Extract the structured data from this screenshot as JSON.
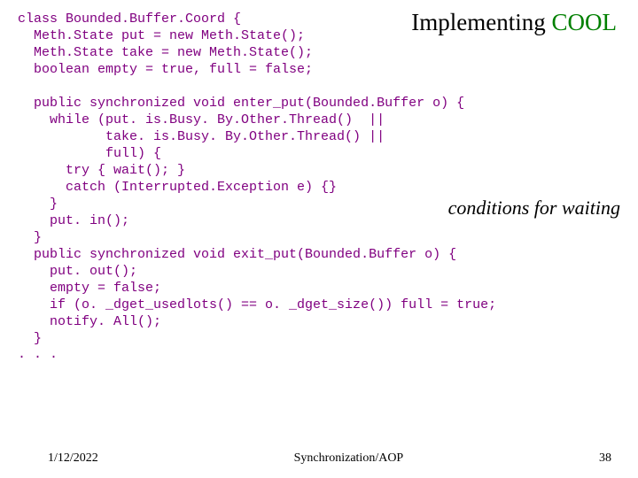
{
  "title": {
    "part1": "Implementing ",
    "part2": "COOL"
  },
  "code": "class Bounded.Buffer.Coord {\n  Meth.State put = new Meth.State();\n  Meth.State take = new Meth.State();\n  boolean empty = true, full = false;\n\n  public synchronized void enter_put(Bounded.Buffer o) {\n    while (put. is.Busy. By.Other.Thread()  ||\n           take. is.Busy. By.Other.Thread() ||\n           full) {\n      try { wait(); }\n      catch (Interrupted.Exception e) {}\n    }\n    put. in();\n  }\n  public synchronized void exit_put(Bounded.Buffer o) {\n    put. out();\n    empty = false;\n    if (o. _dget_usedlots() == o. _dget_size()) full = true;\n    notify. All();\n  }",
  "annotation": "conditions for waiting",
  "ellipsis": ". . .",
  "footer": {
    "date": "1/12/2022",
    "center": "Synchronization/AOP",
    "page": "38"
  }
}
